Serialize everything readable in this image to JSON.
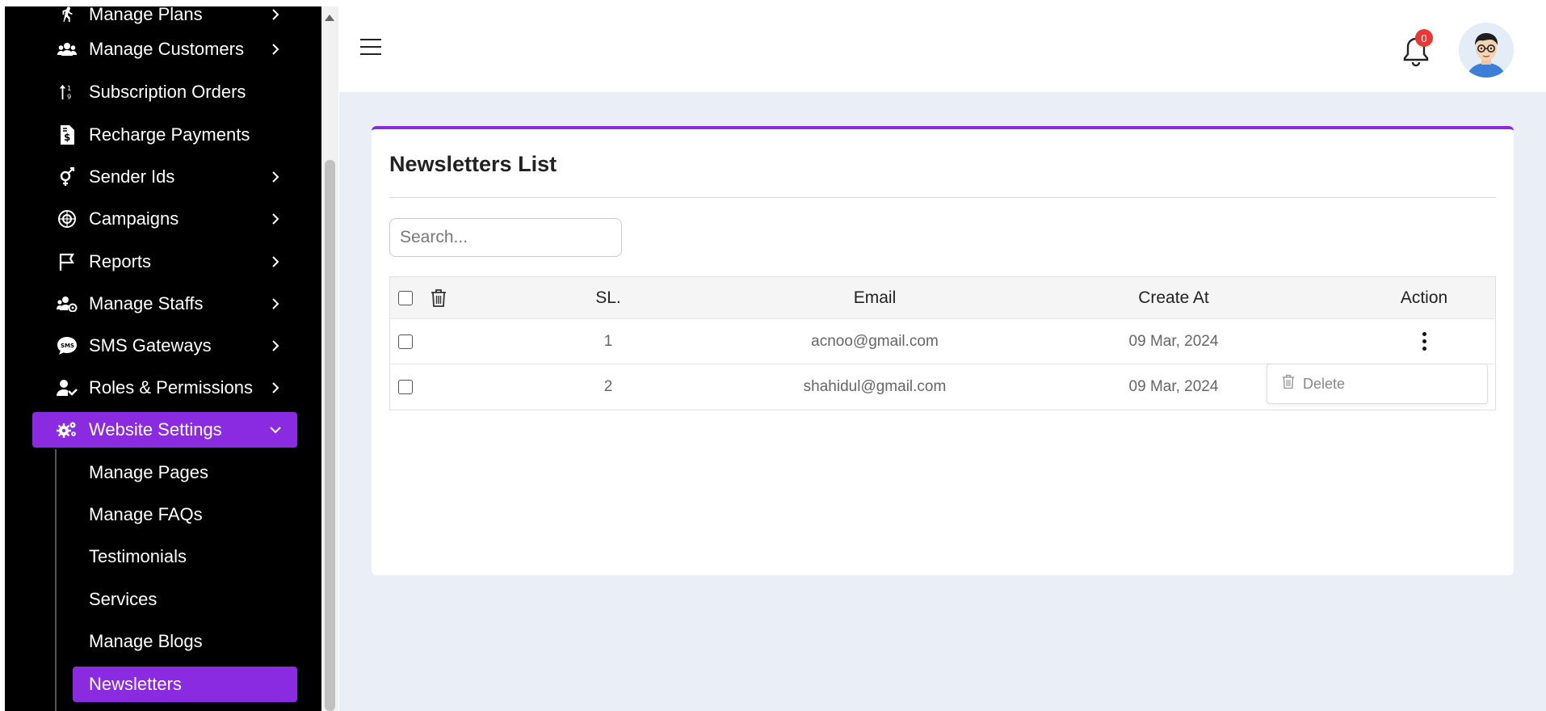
{
  "sidebar": {
    "items": [
      {
        "label": "Manage Plans",
        "icon": "running-person-icon"
      },
      {
        "label": "Manage Customers",
        "icon": "users-icon"
      },
      {
        "label": "Subscription Orders",
        "icon": "sort-icon"
      },
      {
        "label": "Recharge Payments",
        "icon": "invoice-dollar-icon"
      },
      {
        "label": "Sender Ids",
        "icon": "gender-icon"
      },
      {
        "label": "Campaigns",
        "icon": "campaign-icon"
      },
      {
        "label": "Reports",
        "icon": "flag-icon"
      },
      {
        "label": "Manage Staffs",
        "icon": "staff-icon"
      },
      {
        "label": "SMS Gateways",
        "icon": "sms-icon"
      },
      {
        "label": "Roles & Permissions",
        "icon": "user-key-icon"
      },
      {
        "label": "Website Settings",
        "icon": "gears-icon"
      }
    ],
    "sub_items": [
      {
        "label": "Manage Pages"
      },
      {
        "label": "Manage FAQs"
      },
      {
        "label": "Testimonials"
      },
      {
        "label": "Services"
      },
      {
        "label": "Manage Blogs"
      },
      {
        "label": "Newsletters"
      }
    ]
  },
  "header": {
    "notification_count": "0"
  },
  "main": {
    "title": "Newsletters List",
    "search_placeholder": "Search...",
    "table": {
      "headers": {
        "sl": "SL.",
        "email": "Email",
        "created": "Create At",
        "action": "Action"
      },
      "rows": [
        {
          "sl": "1",
          "email": "acnoo@gmail.com",
          "created": "09 Mar, 2024"
        },
        {
          "sl": "2",
          "email": "shahidul@gmail.com",
          "created": "09 Mar, 2024"
        }
      ]
    },
    "dropdown": {
      "delete_label": "Delete"
    }
  },
  "colors": {
    "accent": "#8a2be2",
    "sidebar_bg": "#000000",
    "content_bg": "#eaeef7",
    "badge": "#e53935"
  }
}
